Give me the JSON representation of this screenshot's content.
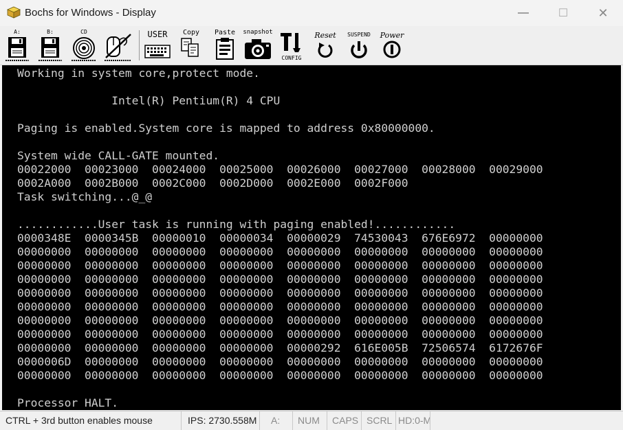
{
  "window": {
    "title": "Bochs for Windows - Display",
    "min_glyph": "—",
    "max_glyph": "☐",
    "close_glyph": "✕"
  },
  "toolbar": {
    "floppy_a_label": "A:",
    "floppy_b_label": "B:",
    "cdrom_label": "CD",
    "user_label": "USER",
    "copy_label": "Copy",
    "paste_label": "Paste",
    "snapshot_label": "snapshot",
    "config_label": "CONFIG",
    "reset_label": "Reset",
    "suspend_label": "SUSPEND",
    "power_label": "Power"
  },
  "console": {
    "lines": [
      "Working in system core,protect mode.",
      "",
      "              Intel(R) Pentium(R) 4 CPU",
      "",
      "Paging is enabled.System core is mapped to address 0x80000000.",
      "",
      "System wide CALL-GATE mounted.",
      "00022000  00023000  00024000  00025000  00026000  00027000  00028000  00029000",
      "0002A000  0002B000  0002C000  0002D000  0002E000  0002F000",
      "Task switching...@_@",
      "",
      "............User task is running with paging enabled!............",
      "0000348E  0000345B  00000010  00000034  00000029  74530043  676E6972  00000000",
      "00000000  00000000  00000000  00000000  00000000  00000000  00000000  00000000",
      "00000000  00000000  00000000  00000000  00000000  00000000  00000000  00000000",
      "00000000  00000000  00000000  00000000  00000000  00000000  00000000  00000000",
      "00000000  00000000  00000000  00000000  00000000  00000000  00000000  00000000",
      "00000000  00000000  00000000  00000000  00000000  00000000  00000000  00000000",
      "00000000  00000000  00000000  00000000  00000000  00000000  00000000  00000000",
      "00000000  00000000  00000000  00000000  00000000  00000000  00000000  00000000",
      "00000000  00000000  00000000  00000000  00000292  616E005B  72506574  6172676F",
      "0000006D  00000000  00000000  00000000  00000000  00000000  00000000  00000000",
      "00000000  00000000  00000000  00000000  00000000  00000000  00000000  00000000",
      "",
      "Processor HALT."
    ]
  },
  "statusbar": {
    "mouse_hint": "CTRL + 3rd button enables mouse",
    "ips": "IPS: 2730.558M",
    "floppy": "A:",
    "num": "NUM",
    "caps": "CAPS",
    "scrl": "SCRL",
    "hd": "HD:0-M"
  }
}
